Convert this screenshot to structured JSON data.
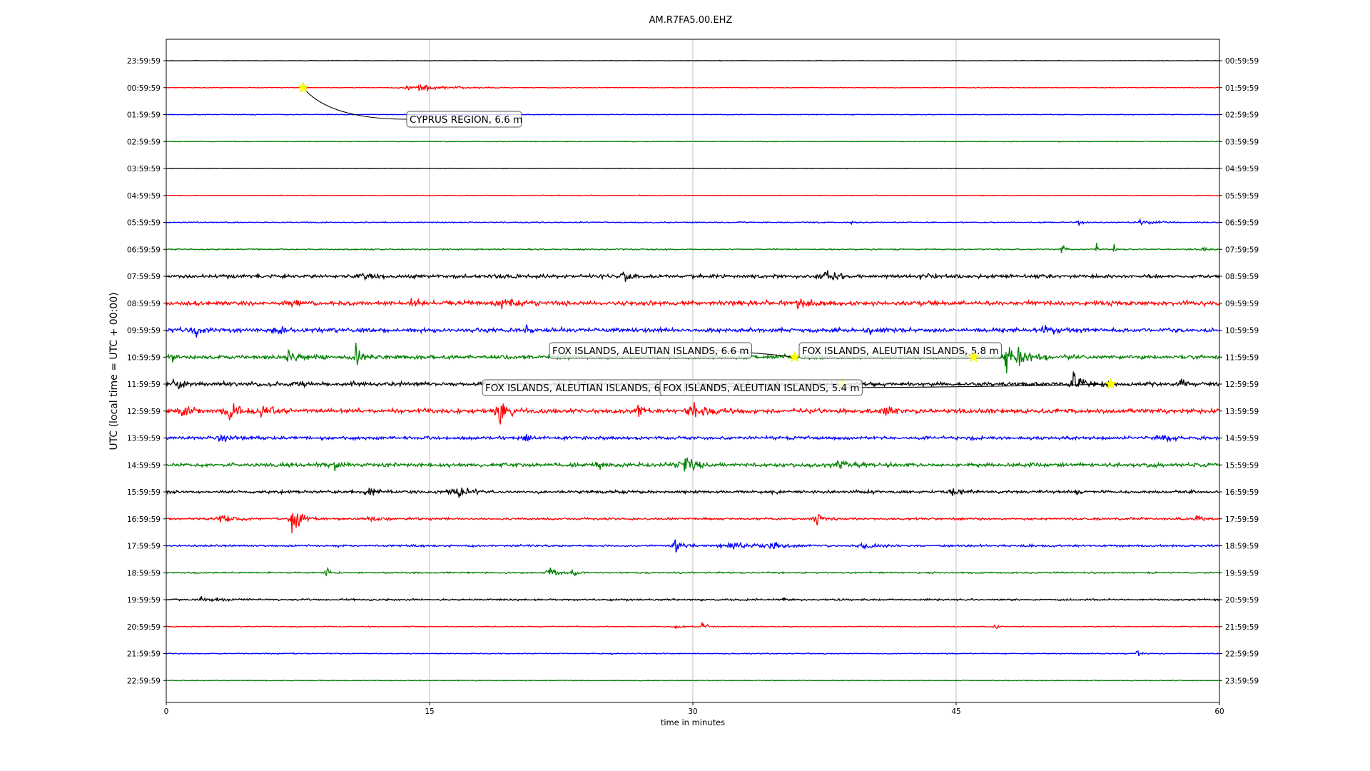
{
  "chart_data": {
    "type": "line",
    "title": "AM.R7FA5.00.EHZ",
    "xlabel": "time in minutes",
    "ylabel": "UTC (local time = UTC + 00:00)",
    "xlim": [
      0,
      60
    ],
    "xticks": [
      0,
      15,
      30,
      45,
      60
    ],
    "grid": "vertical",
    "left_tick_labels": [
      "23:59:59",
      "00:59:59",
      "01:59:59",
      "02:59:59",
      "03:59:59",
      "04:59:59",
      "05:59:59",
      "06:59:59",
      "07:59:59",
      "08:59:59",
      "09:59:59",
      "10:59:59",
      "11:59:59",
      "12:59:59",
      "13:59:59",
      "14:59:59",
      "15:59:59",
      "16:59:59",
      "17:59:59",
      "18:59:59",
      "19:59:59",
      "20:59:59",
      "21:59:59",
      "22:59:59"
    ],
    "right_tick_labels": [
      "00:59:59",
      "01:59:59",
      "02:59:59",
      "03:59:59",
      "04:59:59",
      "05:59:59",
      "06:59:59",
      "07:59:59",
      "08:59:59",
      "09:59:59",
      "10:59:59",
      "11:59:59",
      "12:59:59",
      "13:59:59",
      "14:59:59",
      "15:59:59",
      "16:59:59",
      "17:59:59",
      "18:59:59",
      "19:59:59",
      "20:59:59",
      "21:59:59",
      "22:59:59",
      "23:59:59"
    ],
    "trace_colors": [
      "#000000",
      "#ff0000",
      "#0000ff",
      "#008000"
    ],
    "traces": [
      {
        "noise": 0.25,
        "bursts": []
      },
      {
        "noise": 0.3,
        "bursts": [
          [
            14.2,
            3.2,
            4.0
          ]
        ]
      },
      {
        "noise": 0.35,
        "bursts": []
      },
      {
        "noise": 0.3,
        "bursts": [
          [
            50.8,
            1.8,
            0.3
          ]
        ]
      },
      {
        "noise": 0.25,
        "bursts": []
      },
      {
        "noise": 0.3,
        "bursts": []
      },
      {
        "noise": 0.5,
        "bursts": [
          [
            52,
            3.5,
            0.5
          ],
          [
            55.5,
            3.0,
            1.5
          ],
          [
            39,
            2.0,
            0.4
          ]
        ]
      },
      {
        "noise": 0.6,
        "bursts": [
          [
            51,
            8,
            0.3
          ],
          [
            53,
            7,
            0.2
          ],
          [
            54,
            9,
            0.2
          ],
          [
            59,
            1.5,
            1.0
          ]
        ]
      },
      {
        "noise": 1.6,
        "bursts": [
          [
            11,
            5,
            1.2
          ],
          [
            26,
            4,
            1.0
          ],
          [
            37.5,
            7,
            1.5
          ],
          [
            43,
            3.5,
            1.0
          ]
        ]
      },
      {
        "noise": 2.0,
        "bursts": [
          [
            14,
            4,
            1.5
          ],
          [
            19,
            4,
            1.5
          ],
          [
            36,
            5,
            1.2
          ],
          [
            7,
            3,
            1.0
          ]
        ]
      },
      {
        "noise": 1.8,
        "bursts": [
          [
            1.5,
            5,
            1.5
          ],
          [
            6,
            4,
            1.2
          ],
          [
            20.5,
            5,
            0.6
          ],
          [
            40,
            4,
            1.0
          ],
          [
            50,
            3.5,
            1.5
          ]
        ]
      },
      {
        "noise": 1.8,
        "bursts": [
          [
            0.3,
            6,
            0.5
          ],
          [
            10.8,
            16,
            0.4
          ],
          [
            7,
            5,
            2.0
          ],
          [
            47.8,
            17,
            0.8
          ],
          [
            48.5,
            8,
            1.5
          ]
        ]
      },
      {
        "noise": 1.8,
        "bursts": [
          [
            51.7,
            12,
            1.0
          ],
          [
            0.5,
            5,
            1.0
          ],
          [
            7.5,
            3.5,
            1.0
          ],
          [
            57.8,
            10,
            0.3
          ]
        ]
      },
      {
        "noise": 2.0,
        "bursts": [
          [
            1,
            7,
            0.8
          ],
          [
            3.5,
            10,
            1.2
          ],
          [
            5.5,
            8,
            1.2
          ],
          [
            19,
            9,
            1.5
          ],
          [
            26.9,
            11,
            0.5
          ],
          [
            30,
            7,
            1.5
          ],
          [
            41,
            5,
            1.0
          ]
        ]
      },
      {
        "noise": 1.5,
        "bursts": [
          [
            20.5,
            5,
            0.3
          ],
          [
            56.8,
            3.5,
            1.0
          ],
          [
            3,
            3,
            1.5
          ]
        ]
      },
      {
        "noise": 1.8,
        "bursts": [
          [
            9.6,
            6,
            0.4
          ],
          [
            29.3,
            7,
            1.5
          ],
          [
            24.5,
            4,
            1.0
          ],
          [
            38,
            4,
            1.5
          ]
        ]
      },
      {
        "noise": 1.3,
        "bursts": [
          [
            11.5,
            6,
            1.0
          ],
          [
            16.5,
            7,
            1.5
          ],
          [
            44.8,
            5,
            1.0
          ],
          [
            51.8,
            4,
            0.4
          ]
        ]
      },
      {
        "noise": 1.0,
        "bursts": [
          [
            3.2,
            5,
            1.0
          ],
          [
            7.2,
            15,
            0.8
          ],
          [
            11.5,
            4,
            1.0
          ],
          [
            37,
            9,
            0.6
          ],
          [
            58.7,
            4,
            0.5
          ]
        ]
      },
      {
        "noise": 0.9,
        "bursts": [
          [
            29,
            8,
            0.8
          ],
          [
            32,
            4,
            2.5
          ],
          [
            34.5,
            3.5,
            1.5
          ],
          [
            39.5,
            3,
            1.5
          ]
        ]
      },
      {
        "noise": 0.7,
        "bursts": [
          [
            9.1,
            6,
            0.4
          ],
          [
            21.8,
            7,
            0.8
          ],
          [
            23.1,
            6,
            0.4
          ]
        ]
      },
      {
        "noise": 0.8,
        "bursts": [
          [
            35.2,
            5,
            0.3
          ],
          [
            2,
            2.5,
            1.5
          ]
        ]
      },
      {
        "noise": 0.4,
        "bursts": [
          [
            30.5,
            7,
            0.4
          ],
          [
            47.2,
            5,
            0.3
          ],
          [
            29,
            3,
            0.8
          ]
        ]
      },
      {
        "noise": 0.45,
        "bursts": [
          [
            55.3,
            3.0,
            0.6
          ]
        ]
      },
      {
        "noise": 0.35,
        "bursts": []
      }
    ],
    "events": [
      {
        "label": "CYPRUS REGION, 6.6 m",
        "trace": 1,
        "minute": 7.8
      },
      {
        "label": "FOX ISLANDS, ALEUTIAN ISLANDS, 6.6 m",
        "trace": 11,
        "minute": 35.8
      },
      {
        "label": "FOX ISLANDS, ALEUTIAN ISLANDS, 5.8 m",
        "trace": 11,
        "minute": 46.0
      },
      {
        "label": "FOX ISLANDS, ALEUTIAN ISLANDS, 6.2 m",
        "trace": 12,
        "minute": 38.5
      },
      {
        "label": "FOX ISLANDS, ALEUTIAN ISLANDS, 5.4 m",
        "trace": 12,
        "minute": 53.8
      }
    ]
  }
}
